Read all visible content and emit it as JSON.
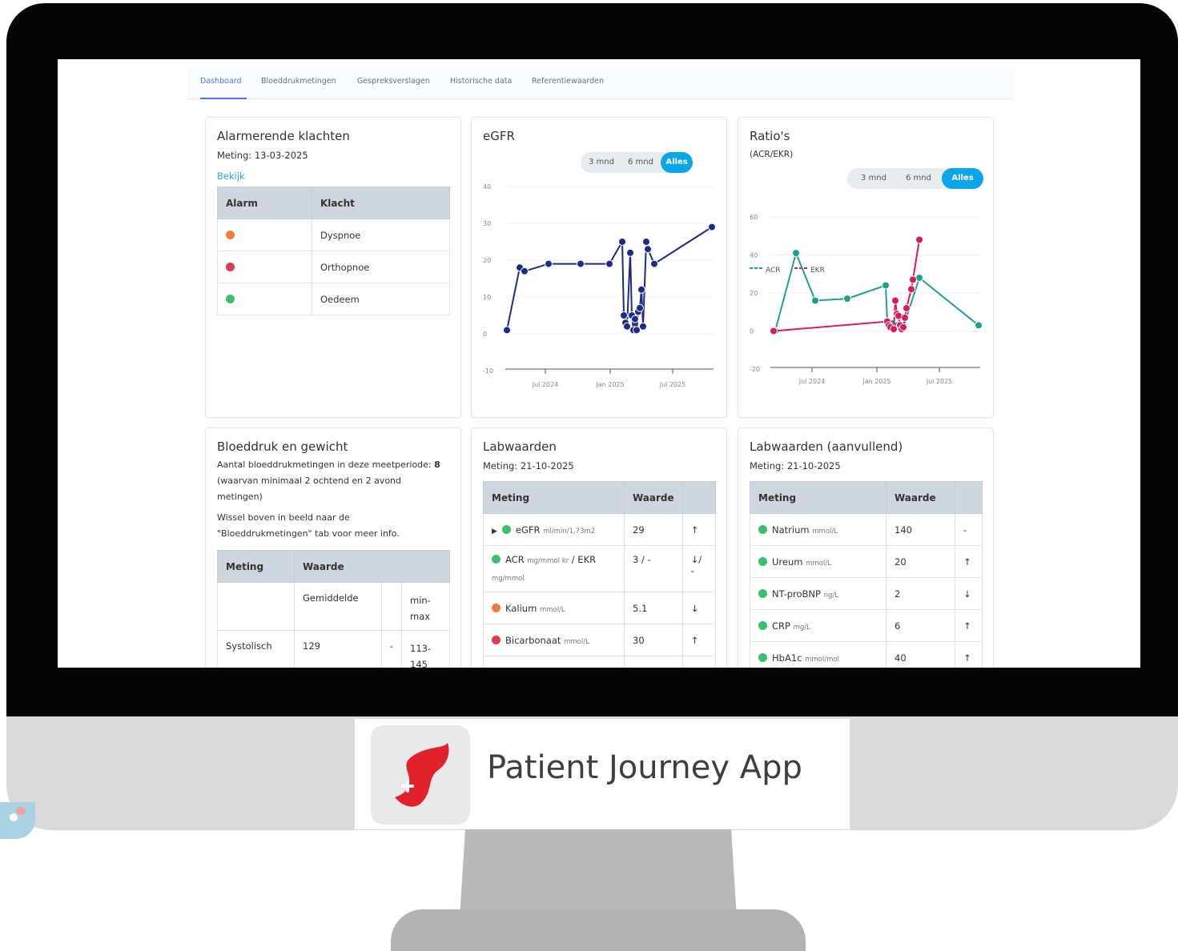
{
  "tabs": [
    {
      "label": "Dashboard",
      "active": true
    },
    {
      "label": "Bloeddrukmetingen",
      "active": false
    },
    {
      "label": "Gespreksverslagen",
      "active": false
    },
    {
      "label": "Historische data",
      "active": false
    },
    {
      "label": "Referentiewaarden",
      "active": false
    }
  ],
  "alarm": {
    "title": "Alarmerende klachten",
    "meting": "Meting: 13-03-2025",
    "link": "Bekijk",
    "headers": [
      "Alarm",
      "Klacht"
    ],
    "rows": [
      {
        "color": "#f07d3a",
        "klacht": "Dyspnoe"
      },
      {
        "color": "#e03a4e",
        "klacht": "Orthopnoe"
      },
      {
        "color": "#3bbf6e",
        "klacht": "Oedeem"
      }
    ]
  },
  "range_buttons": [
    "3 mnd",
    "6 mnd",
    "Alles"
  ],
  "egfr": {
    "title": "eGFR"
  },
  "ratios": {
    "title": "Ratio's",
    "subtitle": "(ACR/EKR)"
  },
  "bloeddruk": {
    "title": "Bloeddruk en gewicht",
    "line1": "Aantal bloeddrukmetingen in deze meetperiode:",
    "count": "8",
    "line2": "(waarvan minimaal 2 ochtend en 2 avond",
    "line3": "metingen)",
    "line4": "Wissel boven in beeld naar de",
    "line5": "\"Bloeddrukmetingen\" tab voor meer info.",
    "headers": [
      "Meting",
      "Waarde"
    ],
    "sub_gem": "Gemiddelde",
    "sub_min": "min-",
    "sub_max": "max",
    "row_label": "Systolisch",
    "row_val": "129",
    "row_dash": "-",
    "row_range1": "113-",
    "row_range2": "145"
  },
  "lab": {
    "title": "Labwaarden",
    "meting": "Meting: 21-10-2025",
    "headers": [
      "Meting",
      "Waarde"
    ],
    "rows": [
      {
        "color": "#3bbf6e",
        "name": "eGFR",
        "unit": "ml/min/1,73m2",
        "value": "29",
        "trend": "↑"
      },
      {
        "color": "#3bbf6e",
        "name": "ACR",
        "unit": "mg/mmol kr",
        "extra": "/ EKR",
        "unit2": "mg/mmol",
        "value": "3 / -",
        "trend": "↓/ -"
      },
      {
        "color": "#f07d3a",
        "name": "Kalium",
        "unit": "mmol/L",
        "value": "5.1",
        "trend": "↓"
      },
      {
        "color": "#e03a4e",
        "name": "Bicarbonaat",
        "unit": "mmol/L",
        "value": "30",
        "trend": "↑"
      }
    ]
  },
  "lab2": {
    "title": "Labwaarden (aanvullend)",
    "meting": "Meting: 21-10-2025",
    "headers": [
      "Meting",
      "Waarde"
    ],
    "rows": [
      {
        "color": "#3bbf6e",
        "name": "Natrium",
        "unit": "mmol/L",
        "value": "140",
        "trend": "-"
      },
      {
        "color": "#3bbf6e",
        "name": "Ureum",
        "unit": "mmol/L",
        "value": "20",
        "trend": "↑"
      },
      {
        "color": "#3bbf6e",
        "name": "NT-proBNP",
        "unit": "ng/L",
        "value": "2",
        "trend": "↓"
      },
      {
        "color": "#3bbf6e",
        "name": "CRP",
        "unit": "mg/L",
        "value": "6",
        "trend": "↑"
      },
      {
        "color": "#3bbf6e",
        "name": "HbA1c",
        "unit": "mmol/mol",
        "value": "40",
        "trend": "↑"
      }
    ]
  },
  "brand": {
    "name": "Patient Journey App",
    "accent": "#e3212d"
  },
  "chart_data": [
    {
      "type": "line",
      "title": "eGFR",
      "ylim": [
        -10,
        40
      ],
      "yticks": [
        40,
        30,
        20,
        10,
        0,
        -10
      ],
      "xticks": [
        "Jul 2024",
        "Jan 2025",
        "Jul 2025"
      ],
      "color": "#1e2a8a",
      "series": [
        {
          "values": [
            1,
            18,
            17,
            19,
            19,
            19,
            25,
            5,
            3,
            2,
            22,
            5,
            1,
            4,
            1,
            6,
            7,
            12,
            2,
            25,
            23,
            19,
            29
          ]
        }
      ]
    },
    {
      "type": "line",
      "title": "Ratio's",
      "ylim": [
        -20,
        60
      ],
      "yticks": [
        60,
        40,
        20,
        0,
        -20
      ],
      "xticks": [
        "Jul 2024",
        "Jan 2025",
        "Jul 2025"
      ],
      "series": [
        {
          "name": "ACR",
          "color": "#1fa08a",
          "values": [
            0,
            41,
            16,
            17,
            24,
            5,
            4,
            3,
            2,
            2,
            28,
            3
          ]
        },
        {
          "name": "EKR",
          "color": "#d81b5c",
          "values": [
            0,
            5,
            3,
            2,
            1,
            16,
            9,
            8,
            3,
            1,
            2,
            7,
            12,
            22,
            27,
            48
          ]
        }
      ],
      "legend": "top-left"
    }
  ]
}
